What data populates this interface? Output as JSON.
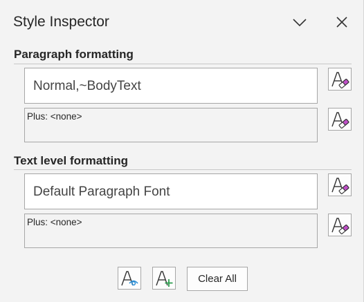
{
  "window": {
    "title": "Style Inspector",
    "collapse_icon": "chevron-down-icon",
    "close_icon": "close-icon"
  },
  "paragraph": {
    "section_title": "Paragraph formatting",
    "style_name": "Normal,~BodyText",
    "plus_text": "Plus: <none>",
    "reset_icon": "clear-formatting-icon"
  },
  "text_level": {
    "section_title": "Text level formatting",
    "style_name": "Default Paragraph Font",
    "plus_text": "Plus: <none>",
    "reset_icon": "clear-formatting-icon"
  },
  "footer": {
    "reveal_icon": "reveal-formatting-icon",
    "new_style_icon": "new-style-icon",
    "clear_all_label": "Clear All"
  },
  "colors": {
    "background": "#f3f3f3",
    "border": "#a6a6a6",
    "eraser": "#c04fc8",
    "accent_blue": "#2b8fd6",
    "accent_green": "#2e9e4f"
  }
}
